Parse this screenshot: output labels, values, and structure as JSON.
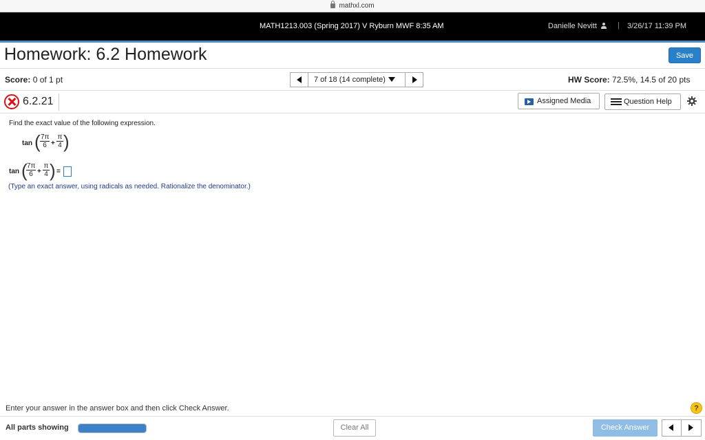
{
  "browser": {
    "url": "mathxl.com"
  },
  "topbar": {
    "course": "MATH1213.003 (Spring 2017) V Ryburn MWF 8:35 AM",
    "user": "Danielle Nevitt",
    "separator": "|",
    "datetime": "3/26/17 11:39 PM"
  },
  "header": {
    "title": "Homework: 6.2 Homework",
    "save_label": "Save"
  },
  "score": {
    "label": "Score:",
    "value": "0 of 1 pt"
  },
  "pager": {
    "text": "7 of 18 (14 complete)"
  },
  "hw_score": {
    "label": "HW Score:",
    "value": "72.5%, 14.5 of 20 pts"
  },
  "question": {
    "number": "6.2.21",
    "assigned_media_label": "Assigned Media",
    "question_help_label": "Question Help",
    "prompt": "Find the exact value of the following expression.",
    "func": "tan",
    "frac1_num": "7π",
    "frac1_den": "6",
    "plus": "+",
    "frac2_num": "π",
    "frac2_den": "4",
    "equals": "=",
    "instruction": "(Type an exact answer, using radicals as needed. Rationalize the denominator.)"
  },
  "footer": {
    "hint": "Enter your answer in the answer box and then click Check Answer.",
    "help_symbol": "?",
    "parts_label": "All parts showing",
    "progress_fraction": 1.0,
    "clear_label": "Clear All",
    "check_label": "Check Answer"
  },
  "colors": {
    "accent": "#2a7fc9",
    "topbar": "#000000",
    "error": "#dd1111"
  }
}
